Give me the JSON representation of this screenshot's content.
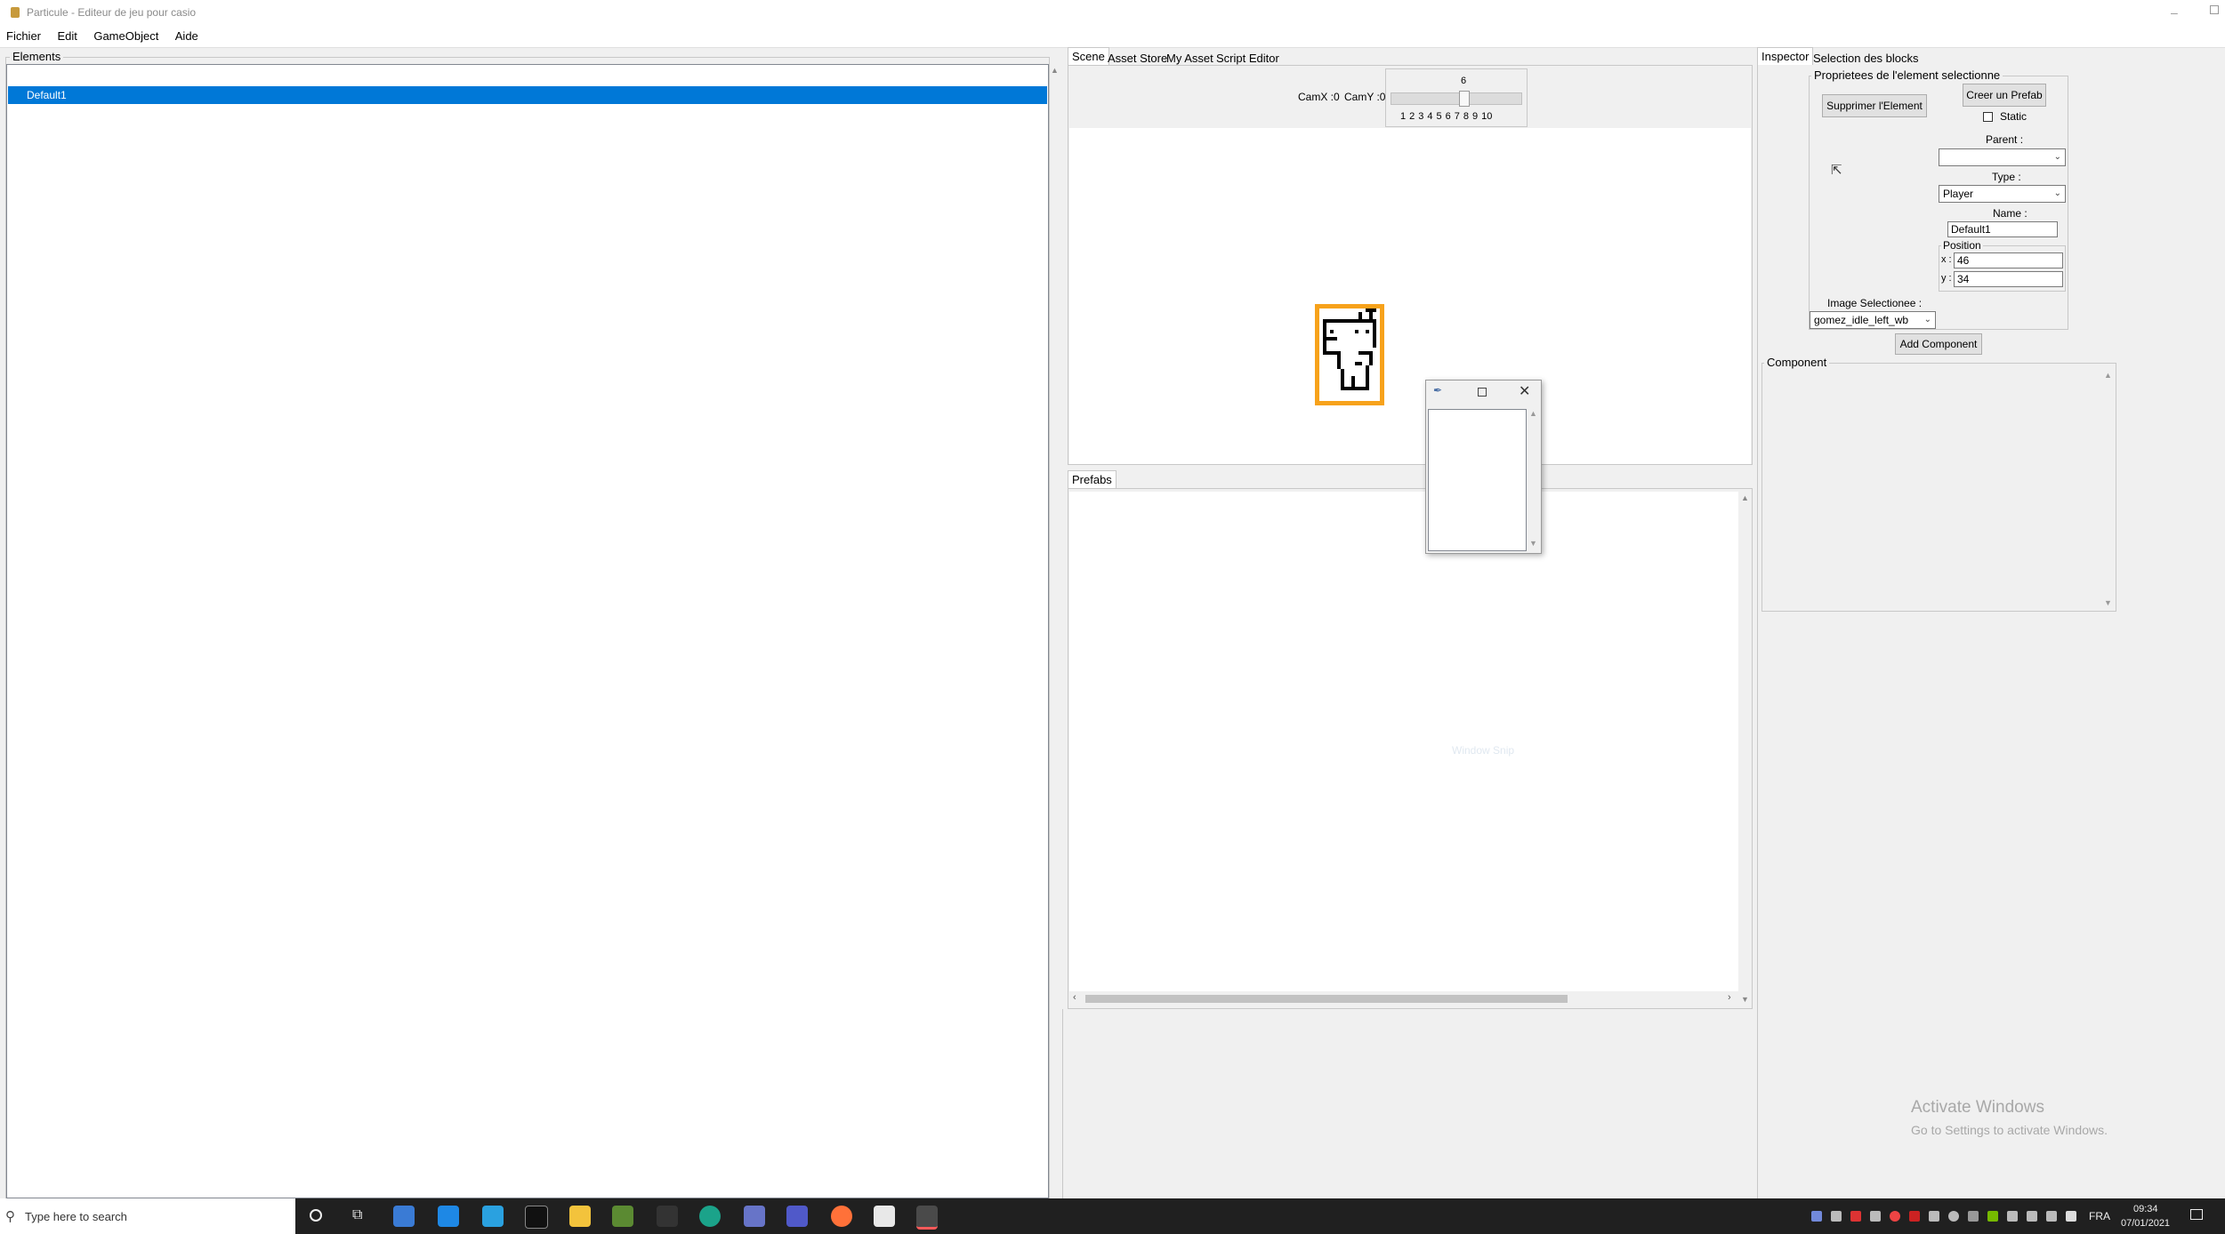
{
  "window": {
    "title": "Particule - Editeur de jeu pour casio"
  },
  "menu": [
    "Fichier",
    "Edit",
    "GameObject",
    "Aide"
  ],
  "elements_panel": {
    "label": "Elements",
    "items": [
      "Default1"
    ]
  },
  "center_tabs": [
    "Scene",
    "Asset Store",
    "My Asset",
    "Script Editor"
  ],
  "scene": {
    "cam_x": "CamX :0",
    "cam_y": "CamY :0",
    "slider_value": "6",
    "slider_level": 6,
    "slider_ticks": [
      "1",
      "2",
      "3",
      "4",
      "5",
      "6",
      "7",
      "8",
      "9",
      "10"
    ]
  },
  "prefabs": {
    "tab": "Prefabs",
    "watermark": "Window Snip"
  },
  "right_tabs": [
    "Inspector",
    "Selection des blocks"
  ],
  "inspector": {
    "group_label": "Proprietees de l'element selectionne",
    "delete_button": "Supprimer l'Element",
    "prefab_button": "Creer un Prefab",
    "static_label": "Static",
    "parent_label": "Parent :",
    "parent_value": "",
    "type_label": "Type :",
    "type_value": "Player",
    "name_label": "Name :",
    "name_value": "Default1",
    "position_label": "Position",
    "x_label": "x :",
    "x_value": "46",
    "y_label": "y :",
    "y_value": "34",
    "image_label": "Image Selectionee :",
    "image_value": "gomez_idle_left_wb",
    "add_component": "Add Component",
    "component_label": "Component"
  },
  "activate": {
    "line1": "Activate Windows",
    "line2": "Go to Settings to activate Windows."
  },
  "taskbar": {
    "search_placeholder": "Type here to search",
    "language": "FRA",
    "time": "09:34",
    "date": "07/01/2021"
  },
  "colors": {
    "selection": "#0078d7",
    "sprite_border": "#f7a21b",
    "taskbar": "#202020"
  }
}
